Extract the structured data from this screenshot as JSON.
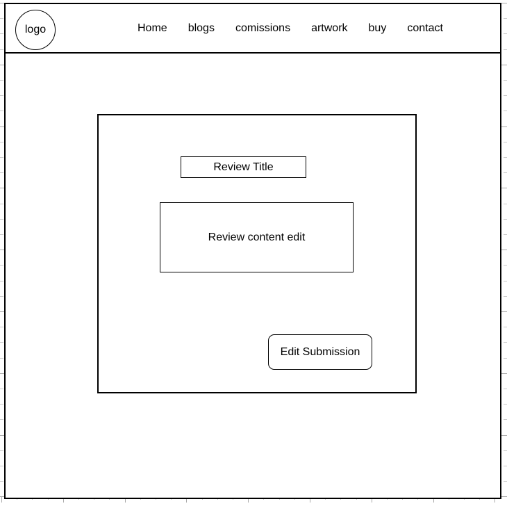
{
  "header": {
    "logo": {
      "label": "logo",
      "shape": "circle"
    },
    "nav_items": [
      {
        "label": "Home"
      },
      {
        "label": "blogs"
      },
      {
        "label": "comissions"
      },
      {
        "label": "artwork"
      },
      {
        "label": "buy"
      },
      {
        "label": "contact"
      }
    ]
  },
  "main": {
    "review_panel": {
      "title_field": {
        "value": "Review Title",
        "placeholder": "Review Title"
      },
      "content_field": {
        "value": "Review content edit",
        "placeholder": "Review content edit"
      },
      "submit_button": {
        "label": "Edit Submission"
      }
    }
  },
  "colors": {
    "stroke": "#000000",
    "background": "#ffffff",
    "ruler_tick": "#c9c9c9",
    "ruler_tick_major": "#a9a9a9"
  }
}
